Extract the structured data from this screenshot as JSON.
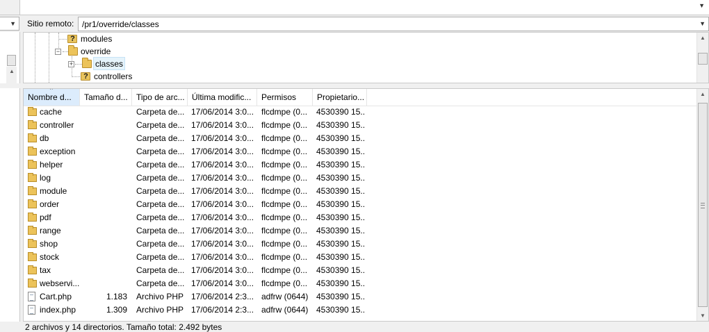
{
  "remote": {
    "label": "Sitio remoto:",
    "path": "/pr1/override/classes"
  },
  "tree": {
    "items": [
      {
        "label": "modules",
        "icon": "folder-question-icon"
      },
      {
        "label": "override",
        "icon": "folder-icon"
      },
      {
        "label": "classes",
        "icon": "folder-icon"
      },
      {
        "label": "controllers",
        "icon": "folder-question-icon"
      }
    ]
  },
  "list": {
    "columns": [
      "Nombre d...",
      "Tamaño d...",
      "Tipo de arc...",
      "Última modific...",
      "Permisos",
      "Propietario..."
    ],
    "rows": [
      {
        "name": "cache",
        "size": "",
        "type": "Carpeta de...",
        "modified": "17/06/2014 3:0...",
        "perms": "flcdmpe (0...",
        "owner": "4530390 15...",
        "icon": "folder-icon"
      },
      {
        "name": "controller",
        "size": "",
        "type": "Carpeta de...",
        "modified": "17/06/2014 3:0...",
        "perms": "flcdmpe (0...",
        "owner": "4530390 15...",
        "icon": "folder-icon"
      },
      {
        "name": "db",
        "size": "",
        "type": "Carpeta de...",
        "modified": "17/06/2014 3:0...",
        "perms": "flcdmpe (0...",
        "owner": "4530390 15...",
        "icon": "folder-icon"
      },
      {
        "name": "exception",
        "size": "",
        "type": "Carpeta de...",
        "modified": "17/06/2014 3:0...",
        "perms": "flcdmpe (0...",
        "owner": "4530390 15...",
        "icon": "folder-icon"
      },
      {
        "name": "helper",
        "size": "",
        "type": "Carpeta de...",
        "modified": "17/06/2014 3:0...",
        "perms": "flcdmpe (0...",
        "owner": "4530390 15...",
        "icon": "folder-icon"
      },
      {
        "name": "log",
        "size": "",
        "type": "Carpeta de...",
        "modified": "17/06/2014 3:0...",
        "perms": "flcdmpe (0...",
        "owner": "4530390 15...",
        "icon": "folder-icon"
      },
      {
        "name": "module",
        "size": "",
        "type": "Carpeta de...",
        "modified": "17/06/2014 3:0...",
        "perms": "flcdmpe (0...",
        "owner": "4530390 15...",
        "icon": "folder-icon"
      },
      {
        "name": "order",
        "size": "",
        "type": "Carpeta de...",
        "modified": "17/06/2014 3:0...",
        "perms": "flcdmpe (0...",
        "owner": "4530390 15...",
        "icon": "folder-icon"
      },
      {
        "name": "pdf",
        "size": "",
        "type": "Carpeta de...",
        "modified": "17/06/2014 3:0...",
        "perms": "flcdmpe (0...",
        "owner": "4530390 15...",
        "icon": "folder-icon"
      },
      {
        "name": "range",
        "size": "",
        "type": "Carpeta de...",
        "modified": "17/06/2014 3:0...",
        "perms": "flcdmpe (0...",
        "owner": "4530390 15...",
        "icon": "folder-icon"
      },
      {
        "name": "shop",
        "size": "",
        "type": "Carpeta de...",
        "modified": "17/06/2014 3:0...",
        "perms": "flcdmpe (0...",
        "owner": "4530390 15...",
        "icon": "folder-icon"
      },
      {
        "name": "stock",
        "size": "",
        "type": "Carpeta de...",
        "modified": "17/06/2014 3:0...",
        "perms": "flcdmpe (0...",
        "owner": "4530390 15...",
        "icon": "folder-icon"
      },
      {
        "name": "tax",
        "size": "",
        "type": "Carpeta de...",
        "modified": "17/06/2014 3:0...",
        "perms": "flcdmpe (0...",
        "owner": "4530390 15...",
        "icon": "folder-icon"
      },
      {
        "name": "webservi...",
        "size": "",
        "type": "Carpeta de...",
        "modified": "17/06/2014 3:0...",
        "perms": "flcdmpe (0...",
        "owner": "4530390 15...",
        "icon": "folder-icon"
      },
      {
        "name": "Cart.php",
        "size": "1.183",
        "type": "Archivo PHP",
        "modified": "17/06/2014 2:3...",
        "perms": "adfrw (0644)",
        "owner": "4530390 15...",
        "icon": "file-icon"
      },
      {
        "name": "index.php",
        "size": "1.309",
        "type": "Archivo PHP",
        "modified": "17/06/2014 2:3...",
        "perms": "adfrw (0644)",
        "owner": "4530390 15...",
        "icon": "file-icon"
      }
    ]
  },
  "status": {
    "text": "2 archivos y 14 directorios. Tamaño total: 2.492 bytes"
  }
}
